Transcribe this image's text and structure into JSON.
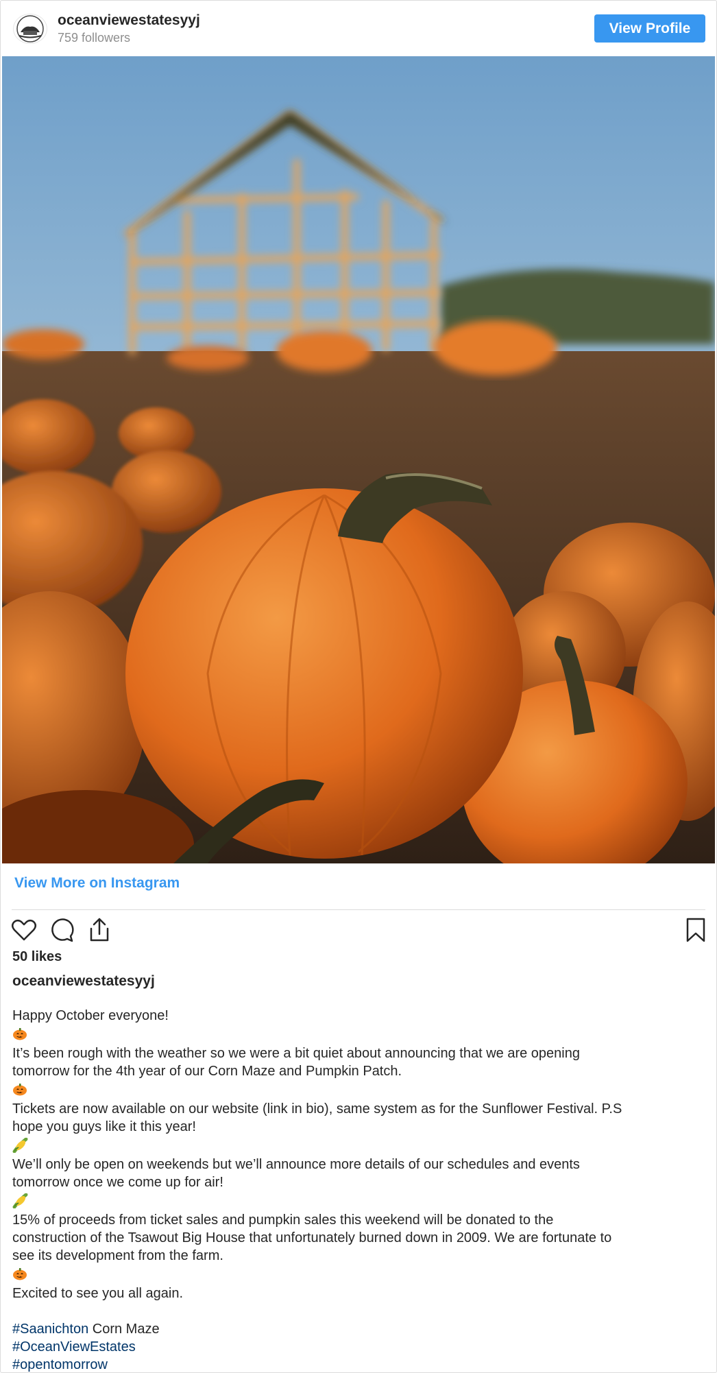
{
  "header": {
    "username": "oceanviewestatesyyj",
    "followers": "759 followers",
    "view_profile_label": "View Profile"
  },
  "photo": {
    "alt": "Pumpkin patch with wooden barn frame in background"
  },
  "view_more_label": "View More on Instagram",
  "likes": "50 likes",
  "caption": {
    "username": "oceanviewestatesyyj",
    "lines": [
      "Happy October everyone!",
      "It’s been rough with the weather so we were a bit quiet about announcing that we are opening",
      "tomorrow for the 4th year of our Corn Maze and Pumpkin Patch.",
      "Tickets are now available on our website (link in bio), same system as for the Sunflower Festival. P.S",
      "hope you guys like it this year!",
      "We’ll only be open on weekends but we’ll announce more details of our schedules and events",
      "tomorrow once we come up for air!",
      "15% of proceeds from ticket sales and pumpkin sales this weekend will be donated to the",
      "construction of the Tsawout Big House that unfortunately burned down in 2009. We are fortunate to",
      "see its development from the farm.",
      "Excited to see you all again."
    ],
    "emojis": [
      "pumpkin-emoji",
      "pumpkin-emoji",
      "corn-emoji",
      "corn-emoji",
      "pumpkin-emoji"
    ],
    "hashtag_1": "#Saanichton",
    "hashtag_1_suffix": " Corn Maze",
    "hashtag_2": "#OceanViewEstates",
    "hashtag_3": "#opentomorrow"
  },
  "icons": {
    "like": "heart-icon",
    "comment": "comment-icon",
    "share": "share-icon",
    "save": "bookmark-icon"
  },
  "colors": {
    "accent": "#3897f0",
    "hashtag": "#003569",
    "text": "#262626",
    "muted": "#8e8e8e"
  }
}
